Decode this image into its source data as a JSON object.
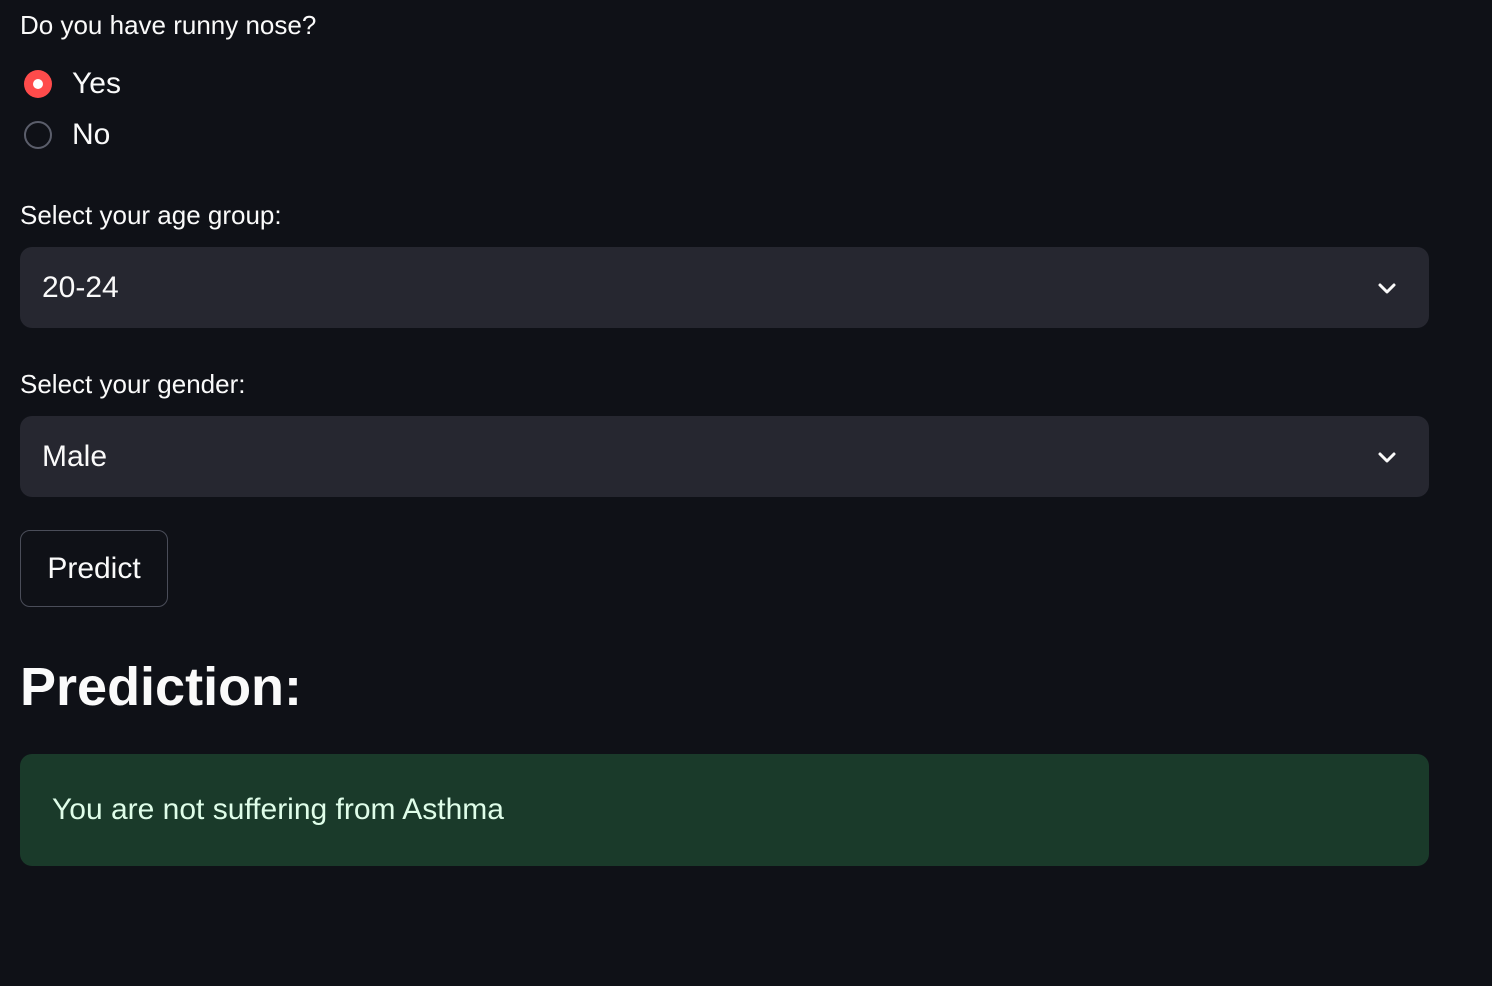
{
  "runny_nose": {
    "question": "Do you have runny nose?",
    "options": [
      {
        "label": "Yes",
        "selected": true
      },
      {
        "label": "No",
        "selected": false
      }
    ]
  },
  "age_group": {
    "label": "Select your age group:",
    "value": "20-24"
  },
  "gender": {
    "label": "Select your gender:",
    "value": "Male"
  },
  "predict_button": {
    "label": "Predict"
  },
  "prediction": {
    "heading": "Prediction:",
    "result": "You are not suffering from Asthma"
  },
  "colors": {
    "background": "#0f1117",
    "accent": "#ff4b4b",
    "select_bg": "#262730",
    "success_bg": "#1a3a2a",
    "success_text": "#dffde9"
  },
  "icons": {
    "dropdown": "chevron-down-icon"
  }
}
